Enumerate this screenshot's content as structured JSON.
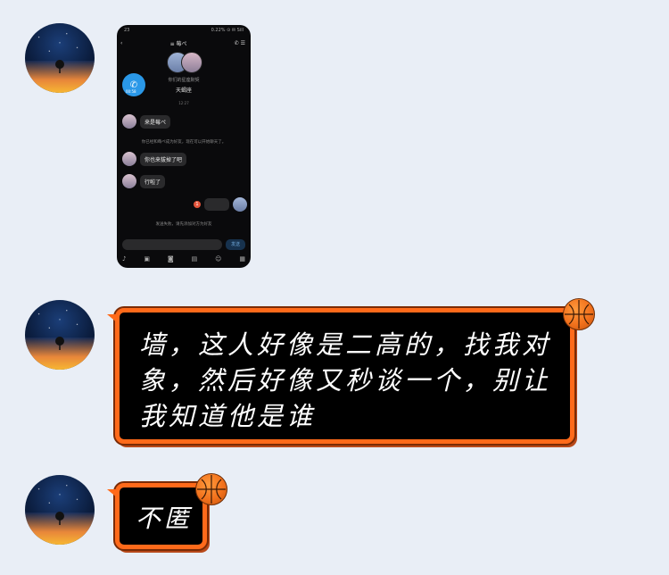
{
  "colors": {
    "background": "#e9eef6",
    "bubble_border": "#ff6a1a",
    "bubble_fill": "#000000",
    "bubble_text": "#ffffff"
  },
  "messages": [
    {
      "type": "image",
      "screenshot": {
        "status_left": "23",
        "status_right": "0.22% ⊙ ✉ Sill",
        "title": "≡ 莓ぺ",
        "call_time": "00:58",
        "couple_label": "你们的星座默契",
        "couple_value": "天蝎座",
        "time": "12:27",
        "bubbles": [
          {
            "text": "来是莓ぺ"
          },
          {
            "text": "你也来拔掉了吧"
          },
          {
            "text": "行啦了"
          }
        ],
        "system_1": "你已经和莓ぺ成为好友，现在可以开始聊天了。",
        "system_2": "发送失败，请先添加对方为好友",
        "unread": "1",
        "send_label": "发送"
      }
    },
    {
      "type": "text",
      "text": "墙，这人好像是二高的，找我对象，然后好像又秒谈一个，别让我知道他是谁"
    },
    {
      "type": "text",
      "text": "不匿"
    }
  ],
  "icons": [
    "avatar",
    "basketball-icon",
    "phone-icon",
    "back-icon",
    "menu-icon",
    "mic-icon",
    "image-icon",
    "camera-icon",
    "folder-icon",
    "emoji-icon",
    "grid-icon"
  ]
}
